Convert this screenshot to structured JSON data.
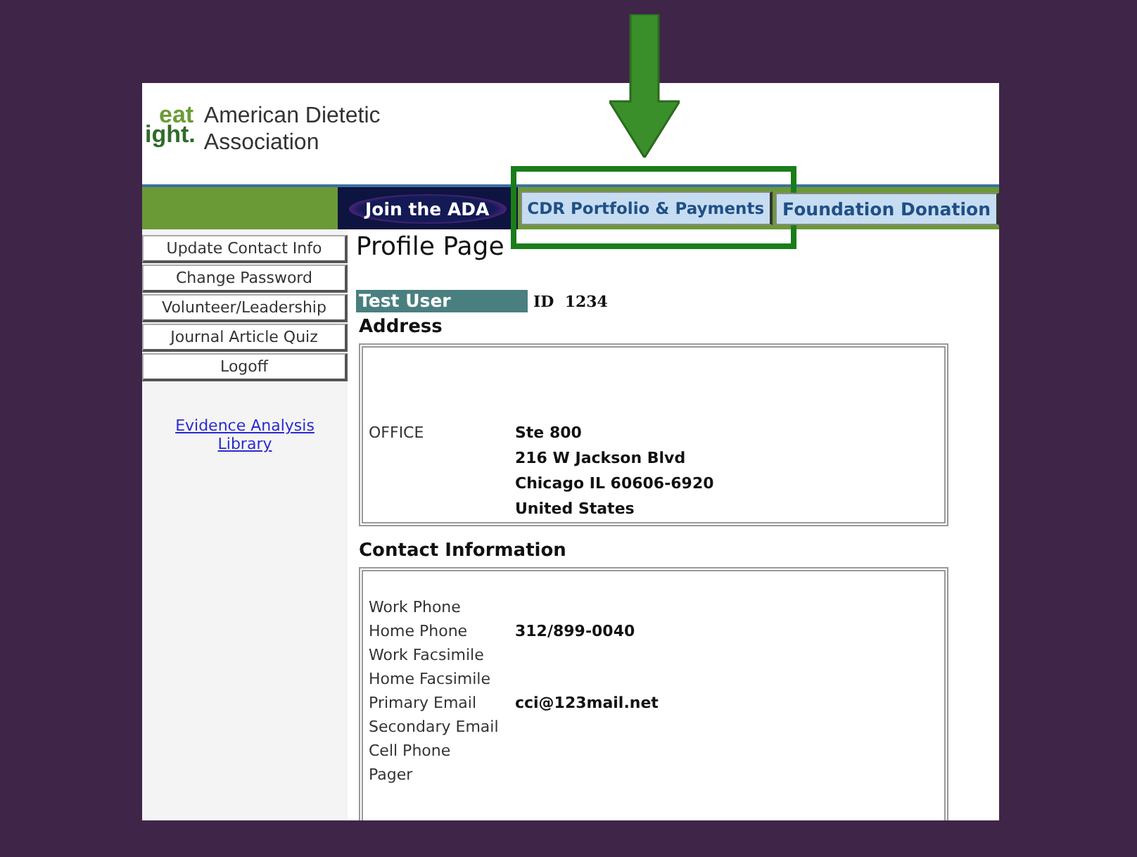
{
  "logo": {
    "mark_top": "eat",
    "mark_bottom": "ight.",
    "name_lines": [
      "American Dietetic",
      "Association"
    ]
  },
  "nav": {
    "join": "Join the ADA",
    "tabs": [
      {
        "label": "CDR Portfolio & Payments",
        "highlighted": true
      },
      {
        "label": "Foundation Donation",
        "highlighted": false
      }
    ]
  },
  "sidebar": {
    "items": [
      "Update Contact Info",
      "Change Password",
      "Volunteer/Leadership",
      "Journal Article Quiz",
      "Logoff"
    ],
    "link": "Evidence Analysis Library"
  },
  "page_title": "Profile Page",
  "user": {
    "name": "Test User",
    "id_label": "ID",
    "id": "1234"
  },
  "address": {
    "heading": "Address",
    "type": "OFFICE",
    "lines": [
      "Ste 800",
      "216 W Jackson Blvd",
      "Chicago IL 60606-6920",
      "United States"
    ]
  },
  "contact": {
    "heading": "Contact Information",
    "rows": [
      {
        "label": "Work Phone"
      },
      {
        "label": "Home Phone",
        "value": "312/899-0040"
      },
      {
        "label": "Work Facsimile"
      },
      {
        "label": "Home Facsimile"
      },
      {
        "label": "Primary Email",
        "value": "cci@123mail.net"
      },
      {
        "label": "Secondary Email"
      },
      {
        "label": "Cell Phone"
      },
      {
        "label": "Pager"
      }
    ]
  }
}
